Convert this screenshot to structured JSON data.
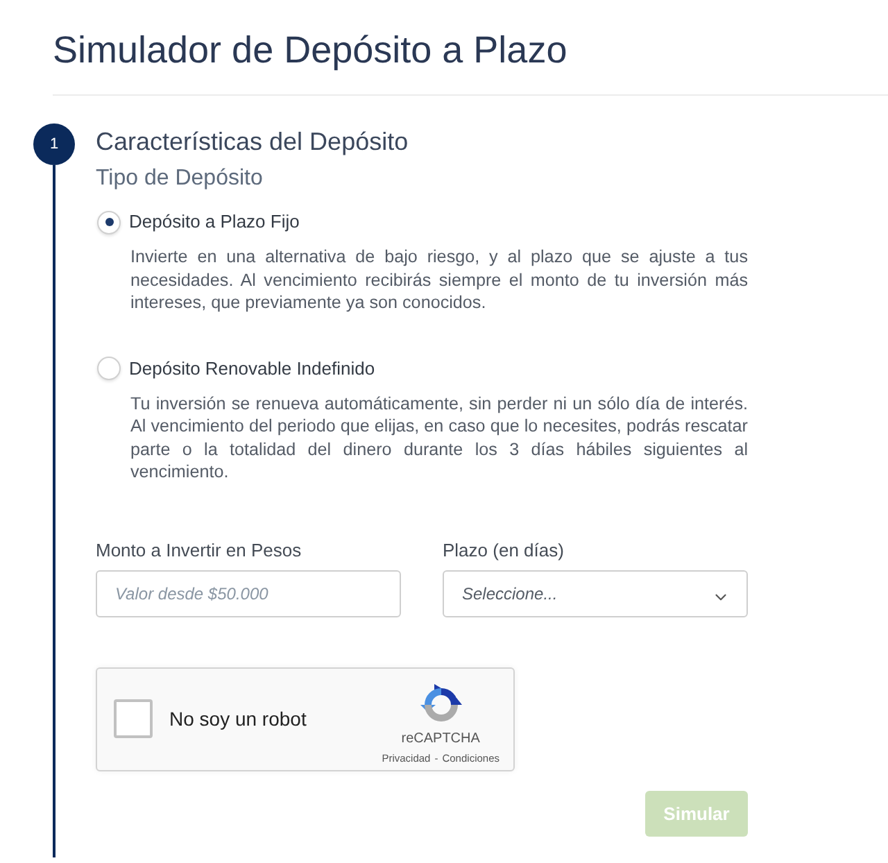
{
  "title": "Simulador de Depósito a Plazo",
  "step": {
    "number": "1",
    "title": "Características del Depósito"
  },
  "deposit_type": {
    "heading": "Tipo de Depósito",
    "options": [
      {
        "label": "Depósito a Plazo Fijo",
        "description": "Invierte en una alternativa de bajo riesgo, y al plazo que se ajuste a tus necesidades. Al vencimiento recibirás siempre el monto de tu inversión más intereses, que previamente ya son conocidos.",
        "selected": true
      },
      {
        "label": "Depósito Renovable Indefinido",
        "description": "Tu inversión se renueva automáticamente, sin perder ni un sólo día de interés. Al vencimiento del periodo que elijas, en caso que lo necesites, podrás rescatar parte o la totalidad del dinero durante los 3 días hábiles siguientes al vencimiento.",
        "selected": false
      }
    ]
  },
  "fields": [
    {
      "kind": "input",
      "label": "Monto a Invertir en Pesos",
      "placeholder": "Valor desde $50.000"
    },
    {
      "kind": "select",
      "label": "Plazo (en días)",
      "placeholder": "Seleccione..."
    }
  ],
  "captcha": {
    "label": "No soy un robot",
    "checked": false,
    "brand": "reCAPTCHA",
    "links": [
      "Privacidad",
      "Condiciones"
    ],
    "separator": "-"
  },
  "submit_button": {
    "label": "Simular",
    "disabled": true
  }
}
